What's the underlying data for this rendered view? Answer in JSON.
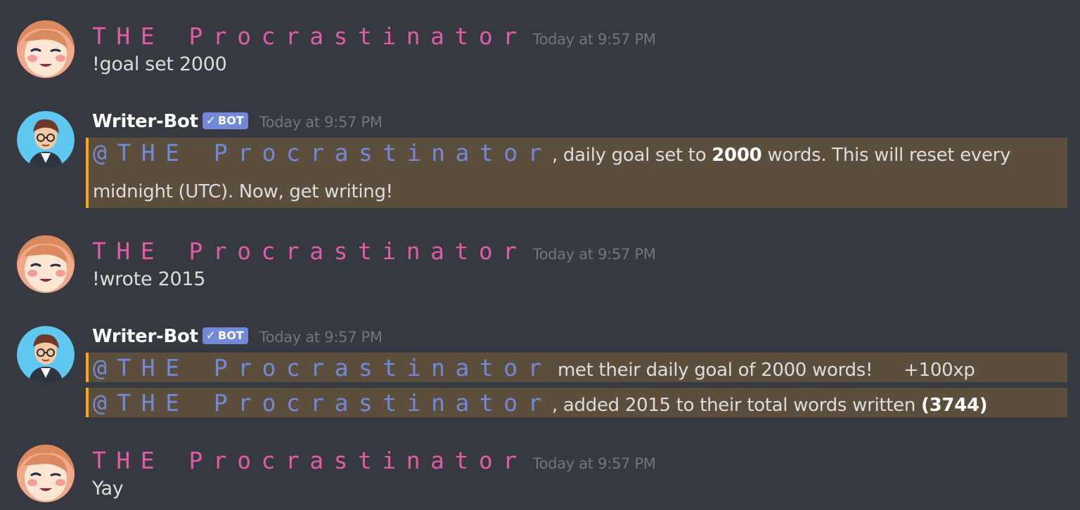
{
  "messages": [
    {
      "author": "THE Procrastinator",
      "timestamp": "Today at 9:57 PM",
      "text": "!goal set 2000"
    },
    {
      "author": "Writer-Bot",
      "badge": "BOT",
      "timestamp": "Today at 9:57 PM",
      "mention": "@THE Procrastinator",
      "line1_pre": ", daily goal set to ",
      "line1_bold": "2000",
      "line1_post": " words. This will reset every",
      "line2": "midnight (UTC). Now, get writing!"
    },
    {
      "author": "THE Procrastinator",
      "timestamp": "Today at 9:57 PM",
      "text": "!wrote 2015"
    },
    {
      "author": "Writer-Bot",
      "badge": "BOT",
      "timestamp": "Today at 9:57 PM",
      "row1_mention": "@THE Procrastinator",
      "row1_text": " met their daily goal of 2000 words!",
      "row1_xp": "+100xp",
      "row2_mention": "@THE Procrastinator",
      "row2_pre": ", added 2015 to their total words written ",
      "row2_bold": "(3744)"
    },
    {
      "author": "THE Procrastinator",
      "timestamp": "Today at 9:57 PM",
      "text": "Yay"
    }
  ],
  "colors": {
    "background": "#36393f",
    "username_pink": "#e05ca4",
    "mention_blue": "#7289da",
    "mention_highlight": "#5b4e3d",
    "mention_border": "#faa61a",
    "bot_badge": "#7289da",
    "timestamp": "#72767d"
  },
  "icons": {
    "user_avatar": "anime-girl-avatar",
    "bot_avatar": "writer-bot-avatar",
    "badge_check": "checkmark-icon"
  }
}
